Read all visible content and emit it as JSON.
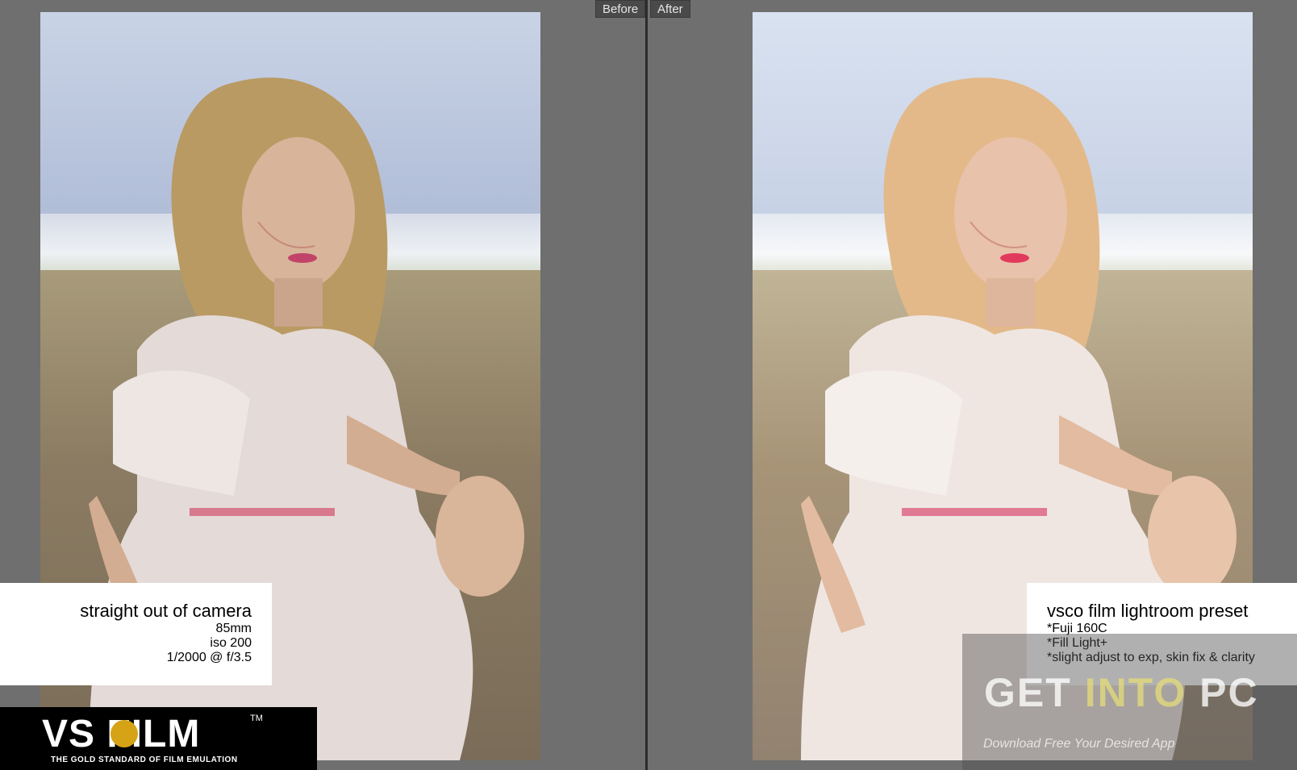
{
  "tabs": {
    "before": "Before",
    "after": "After"
  },
  "left_caption": {
    "title": "straight out of camera",
    "lines": [
      "85mm",
      "iso 200",
      "1/2000 @ f/3.5"
    ]
  },
  "right_caption": {
    "title": "vsco film lightroom preset",
    "lines": [
      "*Fuji 160C",
      "*Fill Light+",
      "*slight adjust to exp, skin fix & clarity"
    ]
  },
  "logo": {
    "word": "VS FILM",
    "tm": "TM",
    "tagline": "THE GOLD STANDARD OF FILM EMULATION"
  },
  "watermark": {
    "title_a": "GET ",
    "title_b": "INTO",
    "title_c": " PC",
    "subtitle": "Download Free Your Desired App"
  },
  "colors": {
    "background": "#6f6f6f",
    "divider": "#2b2b2b",
    "logo_accent": "#d6a317"
  }
}
